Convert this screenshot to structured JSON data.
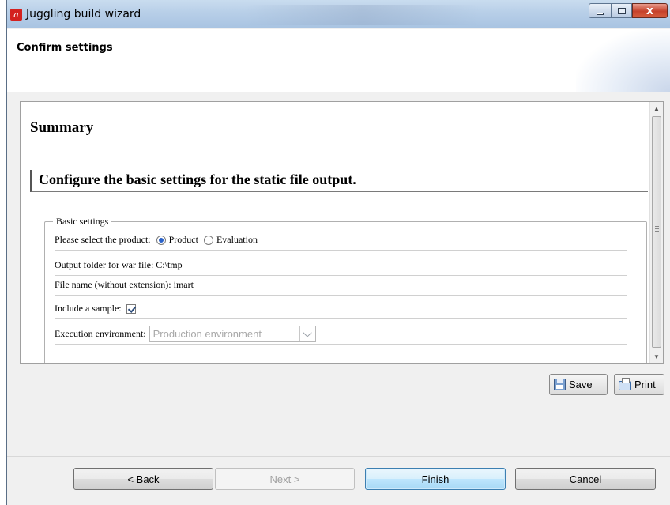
{
  "window": {
    "title": "Juggling build wizard",
    "close_glyph": "x"
  },
  "header": {
    "title": "Confirm settings"
  },
  "content": {
    "summary_title": "Summary",
    "section_heading": "Configure the basic settings for the static file output.",
    "basic_settings": {
      "legend": "Basic settings",
      "product_label": "Please select the product:",
      "product_options": [
        "Product",
        "Evaluation"
      ],
      "product_selected": "Product",
      "output_folder": "Output folder for war file: C:\\tmp",
      "file_name": "File name (without extension): imart",
      "include_sample_label": "Include a sample:",
      "include_sample_checked": true,
      "execution_env_label": "Execution environment:",
      "execution_env_value": "Production environment"
    }
  },
  "actions": {
    "save_label": "Save",
    "print_label": "Print"
  },
  "buttons": {
    "back_prefix": "< ",
    "back_mnemonic": "B",
    "back_rest": "ack",
    "next_mnemonic": "N",
    "next_rest": "ext >",
    "finish_mnemonic": "F",
    "finish_rest": "inish",
    "cancel": "Cancel"
  },
  "colors": {
    "accent": "#2a62c8",
    "finish_border": "#3c7fb1",
    "close_red": "#c5412a"
  }
}
